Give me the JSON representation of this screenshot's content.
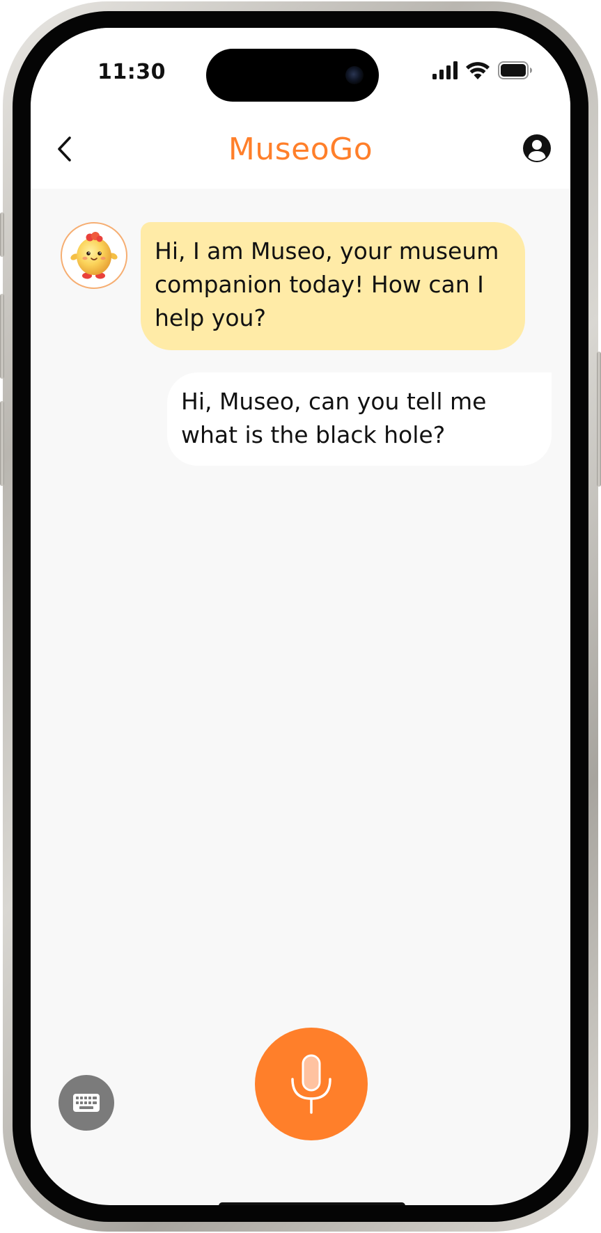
{
  "status_bar": {
    "time": "11:30"
  },
  "header": {
    "title": "MuseoGo",
    "accent_color": "#ff7f2a"
  },
  "icons": {
    "back": "chevron-left-icon",
    "profile": "user-circle-icon",
    "keyboard": "keyboard-icon",
    "microphone": "microphone-icon"
  },
  "chat": {
    "messages": [
      {
        "sender": "bot",
        "text": "Hi, I am Museo, your museum companion today! How can I help you?",
        "bubble_color": "#ffeba7"
      },
      {
        "sender": "user",
        "text": "Hi, Museo, can you tell me what is the black hole?",
        "bubble_color": "#ffffff"
      }
    ]
  }
}
